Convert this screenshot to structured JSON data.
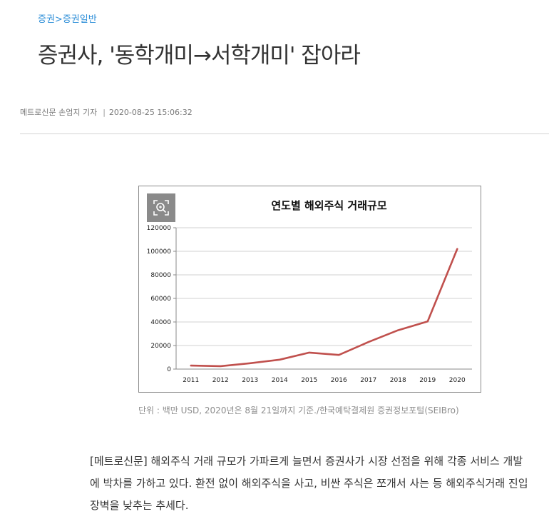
{
  "breadcrumb": {
    "section": "증권",
    "separator": ">",
    "subsection": "증권일반"
  },
  "headline": "증권사, '동학개미→서학개미' 잡아라",
  "byline": {
    "author": "메트로신문 손엄지 기자",
    "separator": "|",
    "datetime": "2020-08-25 15:06:32"
  },
  "figure": {
    "caption": "단위 : 백만 USD, 2020년은 8월 21일까지 기준./한국예탁결제원 증권정보포털(SEIBro)"
  },
  "chart_data": {
    "type": "line",
    "title": "연도별 해외주식 거래규모",
    "xlabel": "",
    "ylabel": "",
    "categories": [
      "2011",
      "2012",
      "2013",
      "2014",
      "2015",
      "2016",
      "2017",
      "2018",
      "2019",
      "2020"
    ],
    "series": [
      {
        "values": [
          3000,
          2500,
          5000,
          8000,
          14000,
          12000,
          23000,
          33000,
          40500,
          102000
        ]
      }
    ],
    "ylim": [
      0,
      120000
    ],
    "yticks": [
      0,
      20000,
      40000,
      60000,
      80000,
      100000,
      120000
    ],
    "grid": true,
    "line_color": "#c0504d"
  },
  "article": {
    "paragraph": "[메트로신문] 해외주식 거래 규모가 가파르게 늘면서 증권사가 시장 선점을 위해 각종 서비스 개발에 박차를 가하고 있다. 환전 없이 해외주식을 사고, 비싼 주식은 쪼개서 사는 등 해외주식거래 진입 장벽을 낮추는 추세다."
  }
}
